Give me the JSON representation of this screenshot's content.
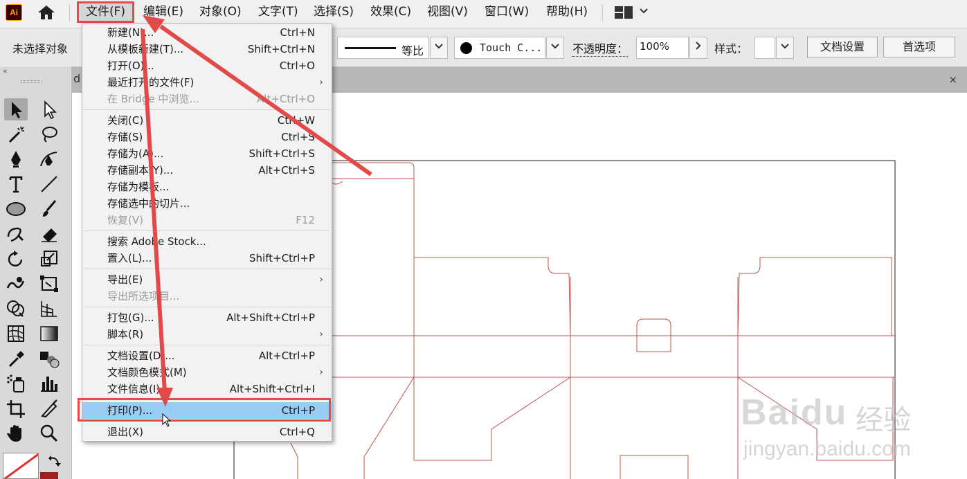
{
  "app": {
    "logo": "Ai"
  },
  "menubar": {
    "items": [
      "文件(F)",
      "编辑(E)",
      "对象(O)",
      "文字(T)",
      "选择(S)",
      "效果(C)",
      "视图(V)",
      "窗口(W)",
      "帮助(H)"
    ],
    "active_index": 0
  },
  "control_bar": {
    "no_selection": "未选择对象",
    "stroke_profile": "等比",
    "brush": "Touch C...",
    "opacity_label": "不透明度：",
    "opacity_value": "100%",
    "style_label": "样式：",
    "doc_setup": "文档设置",
    "preferences": "首选项"
  },
  "tab_strip": {
    "partial_tab_char": "d",
    "close": "×"
  },
  "file_menu": {
    "items": [
      {
        "label": "新建(N)...",
        "shortcut": "Ctrl+N"
      },
      {
        "label": "从模板新建(T)...",
        "shortcut": "Shift+Ctrl+N"
      },
      {
        "label": "打开(O)...",
        "shortcut": "Ctrl+O"
      },
      {
        "label": "最近打开的文件(F)",
        "submenu": true
      },
      {
        "label": "在 Bridge 中浏览...",
        "shortcut": "Alt+Ctrl+O",
        "disabled": true
      },
      {
        "label": "关闭(C)",
        "shortcut": "Ctrl+W"
      },
      {
        "label": "存储(S)",
        "shortcut": "Ctrl+S"
      },
      {
        "label": "存储为(A)...",
        "shortcut": "Shift+Ctrl+S"
      },
      {
        "label": "存储副本(Y)...",
        "shortcut": "Alt+Ctrl+S"
      },
      {
        "label": "存储为模板..."
      },
      {
        "label": "存储选中的切片..."
      },
      {
        "label": "恢复(V)",
        "shortcut": "F12",
        "disabled": true
      },
      {
        "label": "搜索 Adobe Stock..."
      },
      {
        "label": "置入(L)...",
        "shortcut": "Shift+Ctrl+P"
      },
      {
        "label": "导出(E)",
        "submenu": true
      },
      {
        "label": "导出所选项目...",
        "disabled": true
      },
      {
        "label": "打包(G)...",
        "shortcut": "Alt+Shift+Ctrl+P"
      },
      {
        "label": "脚本(R)",
        "submenu": true
      },
      {
        "label": "文档设置(D)...",
        "shortcut": "Alt+Ctrl+P"
      },
      {
        "label": "文档颜色模式(M)",
        "submenu": true
      },
      {
        "label": "文件信息(I)...",
        "shortcut": "Alt+Shift+Ctrl+I"
      },
      {
        "label": "打印(P)...",
        "shortcut": "Ctrl+P",
        "highlighted": true
      },
      {
        "label": "退出(X)",
        "shortcut": "Ctrl+Q"
      }
    ]
  },
  "colors": {
    "annotation_red": "#e24a4a",
    "menu_highlight": "#99ccf5",
    "dieline": "#c0504d"
  },
  "watermark": {
    "brand": "Baidu",
    "cn": "经验",
    "url": "jingyan.baidu.com"
  }
}
